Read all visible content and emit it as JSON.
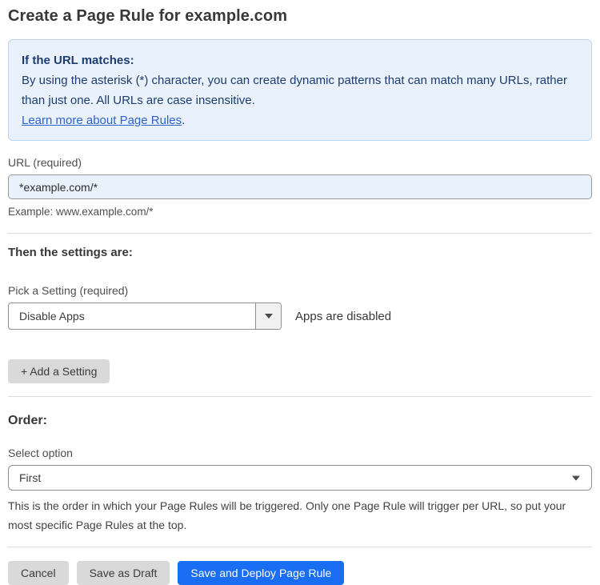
{
  "page": {
    "title": "Create a Page Rule for example.com"
  },
  "info_box": {
    "heading": "If the URL matches:",
    "body": "By using the asterisk (*) character, you can create dynamic patterns that can match many URLs, rather than just one. All URLs are case insensitive.",
    "link_label": "Learn more about Page Rules",
    "link_suffix": "."
  },
  "url_field": {
    "label": "URL (required)",
    "value": "*example.com/*",
    "helper": "Example: www.example.com/*"
  },
  "settings_section": {
    "heading": "Then the settings are:",
    "setting_label": "Pick a Setting (required)",
    "setting_value": "Disable Apps",
    "setting_status": "Apps are disabled",
    "add_setting_label": "+ Add a Setting"
  },
  "order_section": {
    "heading": "Order:",
    "label": "Select option",
    "value": "First",
    "helper": "This is the order in which your Page Rules will be triggered. Only one Page Rule will trigger per URL, so put your most specific Page Rules at the top."
  },
  "actions": {
    "cancel": "Cancel",
    "save_draft": "Save as Draft",
    "save_deploy": "Save and Deploy Page Rule"
  },
  "colors": {
    "accent_blue": "#1a6ef3",
    "info_bg": "#e9f2fc",
    "info_border": "#b9d7f2",
    "info_text": "#1e3c6e",
    "link_blue": "#2f62cc",
    "input_bg": "#e9f1fc",
    "button_gray": "#d9d9d9"
  }
}
